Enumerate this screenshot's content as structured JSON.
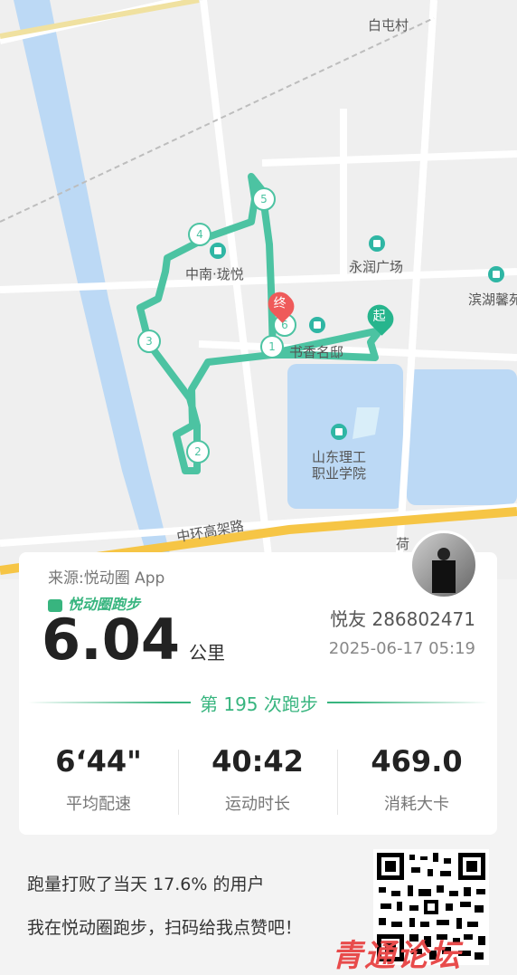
{
  "map": {
    "labels": [
      {
        "text": "白屯村"
      },
      {
        "text": "中南·珑悦"
      },
      {
        "text": "永润广场"
      },
      {
        "text": "滨湖馨苑"
      },
      {
        "text": "书香名邸"
      },
      {
        "text": "山东理工"
      },
      {
        "text": "职业学院"
      },
      {
        "text": "中环高架路"
      },
      {
        "text": "荷"
      }
    ],
    "markers": [
      "1",
      "2",
      "3",
      "4",
      "5",
      "6"
    ],
    "start_label": "起",
    "end_label": "终"
  },
  "card": {
    "source": "来源:悦动圈 App",
    "brand": "悦动圈跑步",
    "distance": "6.04",
    "unit": "公里",
    "friend": "悦友 286802471",
    "datetime": "2025-06-17 05:19",
    "run_count": "第 195 次跑步",
    "stats": [
      {
        "value": "6‘44\"",
        "label": "平均配速"
      },
      {
        "value": "40:42",
        "label": "运动时长"
      },
      {
        "value": "469.0",
        "label": "消耗大卡"
      }
    ]
  },
  "footer": {
    "line1": "跑量打败了当天 17.6% 的用户",
    "line2": "我在悦动圈跑步，扫码给我点赞吧！"
  },
  "watermark": "青通论坛",
  "colors": {
    "route": "#4cc3a2",
    "accent": "#38b57f",
    "water": "#bcd9f5",
    "end_pin": "#ef5a5a"
  }
}
